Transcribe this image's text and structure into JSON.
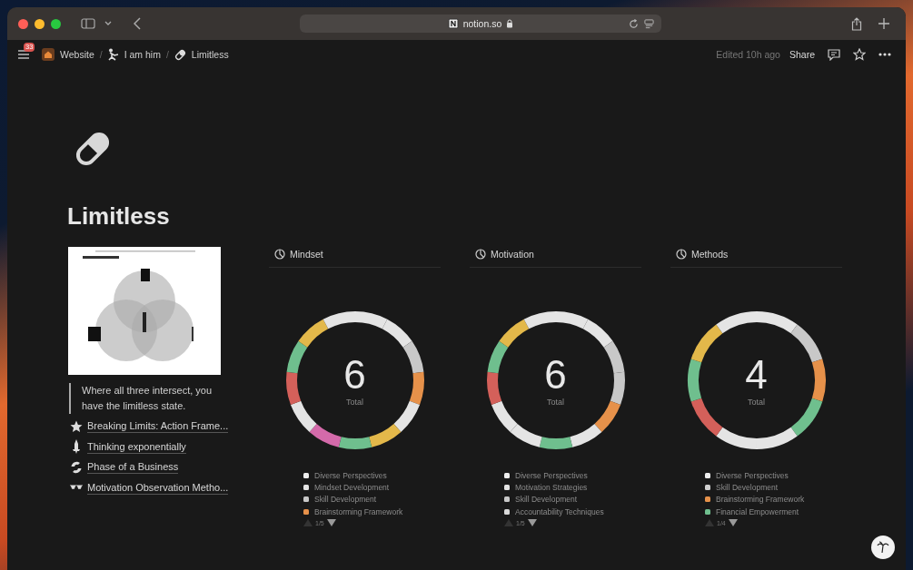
{
  "browser": {
    "address": "notion.so"
  },
  "topbar": {
    "notification_count": "33",
    "separator": "/",
    "breadcrumbs": [
      {
        "label": "Website",
        "kind": "home"
      },
      {
        "label": "I am him",
        "kind": "figure"
      },
      {
        "label": "Limitless",
        "kind": "pill"
      }
    ],
    "edited": "Edited 10h ago",
    "share": "Share"
  },
  "page": {
    "title": "Limitless",
    "quote": "Where all three intersect, you have the limitless state.",
    "links": [
      {
        "label": "Breaking Limits: Action Frame...",
        "kind": "star"
      },
      {
        "label": "Thinking exponentially",
        "kind": "rocket"
      },
      {
        "label": "Phase of a Business",
        "kind": "cycle"
      },
      {
        "label": "Motivation Observation Metho...",
        "kind": "glasses"
      }
    ]
  },
  "charts": [
    {
      "title": "Mindset",
      "total": "6",
      "total_label": "Total",
      "pager": "1/5",
      "segments": [
        {
          "color": "#e4e4e4"
        },
        {
          "color": "#e4e4e4"
        },
        {
          "color": "#c8c8c8"
        },
        {
          "color": "#e6914a"
        },
        {
          "color": "#e4e4e4"
        },
        {
          "color": "#e3b84a"
        },
        {
          "color": "#6fbf8e"
        },
        {
          "color": "#d46aaa"
        },
        {
          "color": "#e4e4e4"
        },
        {
          "color": "#d4605a"
        },
        {
          "color": "#6fbf8e"
        },
        {
          "color": "#e3b84a"
        },
        {
          "color": "#e4e4e4"
        }
      ],
      "legend": [
        {
          "label": "Diverse Perspectives",
          "color": "#eeeeee"
        },
        {
          "label": "Mindset Development",
          "color": "#e4e4e4"
        },
        {
          "label": "Skill Development",
          "color": "#c8c8c8"
        },
        {
          "label": "Brainstorming Framework",
          "color": "#e6914a"
        }
      ]
    },
    {
      "title": "Motivation",
      "total": "6",
      "total_label": "Total",
      "pager": "1/5",
      "segments": [
        {
          "color": "#e4e4e4"
        },
        {
          "color": "#e4e4e4"
        },
        {
          "color": "#c8c8c8"
        },
        {
          "color": "#c8c8c8"
        },
        {
          "color": "#e6914a"
        },
        {
          "color": "#e4e4e4"
        },
        {
          "color": "#6fbf8e"
        },
        {
          "color": "#e4e4e4"
        },
        {
          "color": "#e4e4e4"
        },
        {
          "color": "#d4605a"
        },
        {
          "color": "#6fbf8e"
        },
        {
          "color": "#e3b84a"
        },
        {
          "color": "#e4e4e4"
        }
      ],
      "legend": [
        {
          "label": "Diverse Perspectives",
          "color": "#eeeeee"
        },
        {
          "label": "Motivation Strategies",
          "color": "#e4e4e4"
        },
        {
          "label": "Skill Development",
          "color": "#c8c8c8"
        },
        {
          "label": "Accountability Techniques",
          "color": "#d9d9d9"
        }
      ]
    },
    {
      "title": "Methods",
      "total": "4",
      "total_label": "Total",
      "pager": "1/4",
      "segments": [
        {
          "color": "#e4e4e4"
        },
        {
          "color": "#c8c8c8"
        },
        {
          "color": "#e6914a"
        },
        {
          "color": "#6fbf8e"
        },
        {
          "color": "#e4e4e4"
        },
        {
          "color": "#e4e4e4"
        },
        {
          "color": "#d4605a"
        },
        {
          "color": "#6fbf8e"
        },
        {
          "color": "#e3b84a"
        },
        {
          "color": "#e4e4e4"
        }
      ],
      "legend": [
        {
          "label": "Diverse Perspectives",
          "color": "#eeeeee"
        },
        {
          "label": "Skill Development",
          "color": "#d0d0d0"
        },
        {
          "label": "Brainstorming Framework",
          "color": "#e6914a"
        },
        {
          "label": "Financial Empowerment",
          "color": "#6fbf8e"
        }
      ]
    }
  ]
}
